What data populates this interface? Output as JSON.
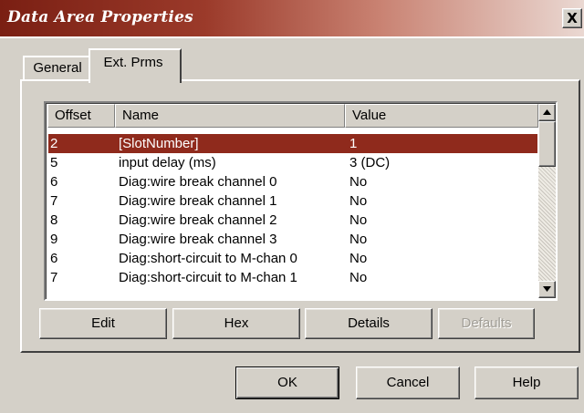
{
  "window": {
    "title": "Data Area Properties",
    "close_glyph": "X",
    "title_gradient": [
      "#7a1f13",
      "#ead8d2"
    ]
  },
  "tabs": [
    {
      "label": "General",
      "active": false
    },
    {
      "label": "Ext. Prms",
      "active": true
    }
  ],
  "table": {
    "columns": [
      "Offset",
      "Name",
      "Value"
    ],
    "rows": [
      {
        "offset": "2",
        "name": "[SlotNumber]",
        "value": "1",
        "selected": true
      },
      {
        "offset": "5",
        "name": "input delay (ms)",
        "value": "3 (DC)"
      },
      {
        "offset": "6",
        "name": "Diag:wire break channel 0",
        "value": "No"
      },
      {
        "offset": "7",
        "name": "Diag:wire break channel 1",
        "value": "No"
      },
      {
        "offset": "8",
        "name": "Diag:wire break channel 2",
        "value": "No"
      },
      {
        "offset": "9",
        "name": "Diag:wire break channel 3",
        "value": "No"
      },
      {
        "offset": "6",
        "name": "Diag:short-circuit to M-chan 0",
        "value": "No"
      },
      {
        "offset": "7",
        "name": "Diag:short-circuit to M-chan 1",
        "value": "No"
      }
    ],
    "selection_color": "#8f2a1c"
  },
  "panel_buttons": {
    "edit": "Edit",
    "hex": "Hex",
    "details": "Details",
    "defaults": "Defaults"
  },
  "dialog_buttons": {
    "ok": "OK",
    "cancel": "Cancel",
    "help": "Help"
  },
  "icons": {
    "scroll_up": "triangle-up-icon",
    "scroll_down": "triangle-down-icon",
    "close": "close-icon"
  }
}
